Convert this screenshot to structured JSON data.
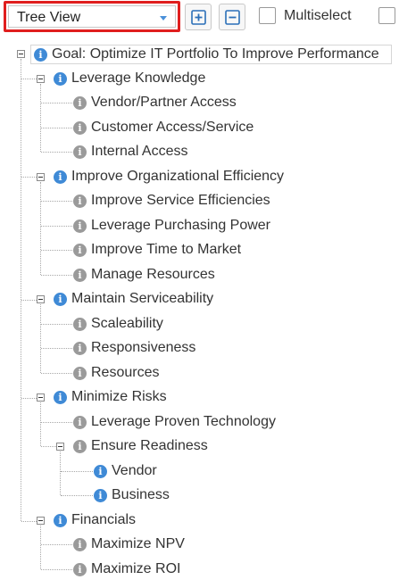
{
  "toolbar": {
    "view_select_value": "Tree View",
    "expand_all_icon": "plus-square-icon",
    "collapse_all_icon": "minus-square-icon",
    "multiselect_label": "Multiselect",
    "highlight_color": "#e01e1e"
  },
  "tree": {
    "root": {
      "label": "Goal: Optimize IT Portfolio To Improve Performance",
      "children": [
        {
          "label": "Leverage Knowledge",
          "children": [
            {
              "label": "Vendor/Partner Access"
            },
            {
              "label": "Customer Access/Service"
            },
            {
              "label": "Internal Access"
            }
          ]
        },
        {
          "label": "Improve Organizational Efficiency",
          "children": [
            {
              "label": "Improve Service Efficiencies"
            },
            {
              "label": "Leverage Purchasing Power"
            },
            {
              "label": "Improve Time to Market"
            },
            {
              "label": "Manage Resources"
            }
          ]
        },
        {
          "label": "Maintain Serviceability",
          "children": [
            {
              "label": "Scaleability"
            },
            {
              "label": "Responsiveness"
            },
            {
              "label": "Resources"
            }
          ]
        },
        {
          "label": "Minimize Risks",
          "children": [
            {
              "label": "Leverage Proven Technology"
            },
            {
              "label": "Ensure Readiness",
              "children": [
                {
                  "label": "Vendor"
                },
                {
                  "label": "Business"
                }
              ]
            }
          ]
        },
        {
          "label": "Financials",
          "children": [
            {
              "label": "Maximize NPV"
            },
            {
              "label": "Maximize ROI"
            }
          ]
        }
      ]
    }
  }
}
